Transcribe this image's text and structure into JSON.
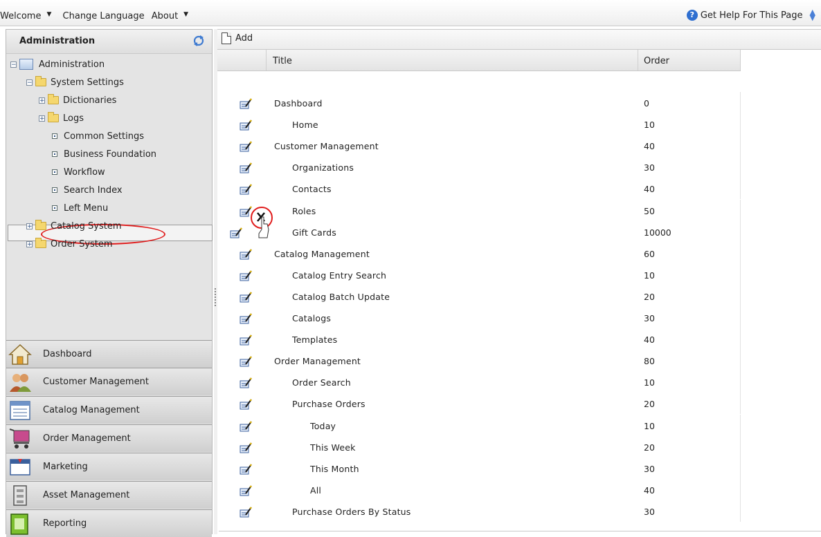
{
  "topbar": {
    "menus": [
      {
        "label": "Welcome",
        "has_dropdown": true
      },
      {
        "label": "Change Language",
        "has_dropdown": false
      },
      {
        "label": "About",
        "has_dropdown": true
      }
    ],
    "help_label": "Get Help For This Page"
  },
  "left_panel": {
    "title": "Administration",
    "tree": [
      {
        "label": "Administration",
        "expander": "minus",
        "icon": "admin-icon"
      },
      {
        "label": "System Settings",
        "expander": "minus",
        "icon": "folder-icon"
      },
      {
        "label": "Dictionaries",
        "expander": "plus",
        "icon": "folder-icon"
      },
      {
        "label": "Logs",
        "expander": "plus",
        "icon": "folder-icon"
      },
      {
        "label": "Common Settings",
        "icon": "leaf-icon"
      },
      {
        "label": "Business Foundation",
        "icon": "leaf-icon"
      },
      {
        "label": "Workflow",
        "icon": "leaf-icon"
      },
      {
        "label": "Search Index",
        "icon": "leaf-icon"
      },
      {
        "label": "Left Menu",
        "icon": "leaf-icon",
        "selected": true
      },
      {
        "label": "Catalog System",
        "expander": "plus",
        "icon": "folder-icon"
      },
      {
        "label": "Order System",
        "expander": "plus",
        "icon": "folder-icon"
      }
    ],
    "nav_buttons": [
      {
        "label": "Dashboard",
        "icon": "home-icon"
      },
      {
        "label": "Customer Management",
        "icon": "users-icon"
      },
      {
        "label": "Catalog Management",
        "icon": "catalog-icon"
      },
      {
        "label": "Order Management",
        "icon": "cart-icon"
      },
      {
        "label": "Marketing",
        "icon": "marketing-icon"
      },
      {
        "label": "Asset Management",
        "icon": "asset-icon"
      },
      {
        "label": "Reporting",
        "icon": "reporting-icon"
      }
    ]
  },
  "toolbar": {
    "add_label": "Add"
  },
  "grid": {
    "columns": [
      "Title",
      "Order"
    ],
    "rows": [
      {
        "title": "Dashboard",
        "order": "0",
        "level": 0
      },
      {
        "title": "Home",
        "order": "10",
        "level": 1
      },
      {
        "title": "Customer Management",
        "order": "40",
        "level": 0
      },
      {
        "title": "Organizations",
        "order": "30",
        "level": 1
      },
      {
        "title": "Contacts",
        "order": "40",
        "level": 1
      },
      {
        "title": "Roles",
        "order": "50",
        "level": 1
      },
      {
        "title": "Gift Cards",
        "order": "10000",
        "level": 1
      },
      {
        "title": "Catalog Management",
        "order": "60",
        "level": 0
      },
      {
        "title": "Catalog Entry Search",
        "order": "10",
        "level": 1
      },
      {
        "title": "Catalog Batch Update",
        "order": "20",
        "level": 1
      },
      {
        "title": "Catalogs",
        "order": "30",
        "level": 1
      },
      {
        "title": "Templates",
        "order": "40",
        "level": 1
      },
      {
        "title": "Order Management",
        "order": "80",
        "level": 0
      },
      {
        "title": "Order Search",
        "order": "10",
        "level": 1
      },
      {
        "title": "Purchase Orders",
        "order": "20",
        "level": 1
      },
      {
        "title": "Today",
        "order": "10",
        "level": 2
      },
      {
        "title": "This Week",
        "order": "20",
        "level": 2
      },
      {
        "title": "This Month",
        "order": "30",
        "level": 2
      },
      {
        "title": "All",
        "order": "40",
        "level": 2
      },
      {
        "title": "Purchase Orders By Status",
        "order": "30",
        "level": 1
      }
    ]
  },
  "colors": {
    "highlight_ring": "#e01b1b",
    "help_icon": "#2f6fd0"
  }
}
